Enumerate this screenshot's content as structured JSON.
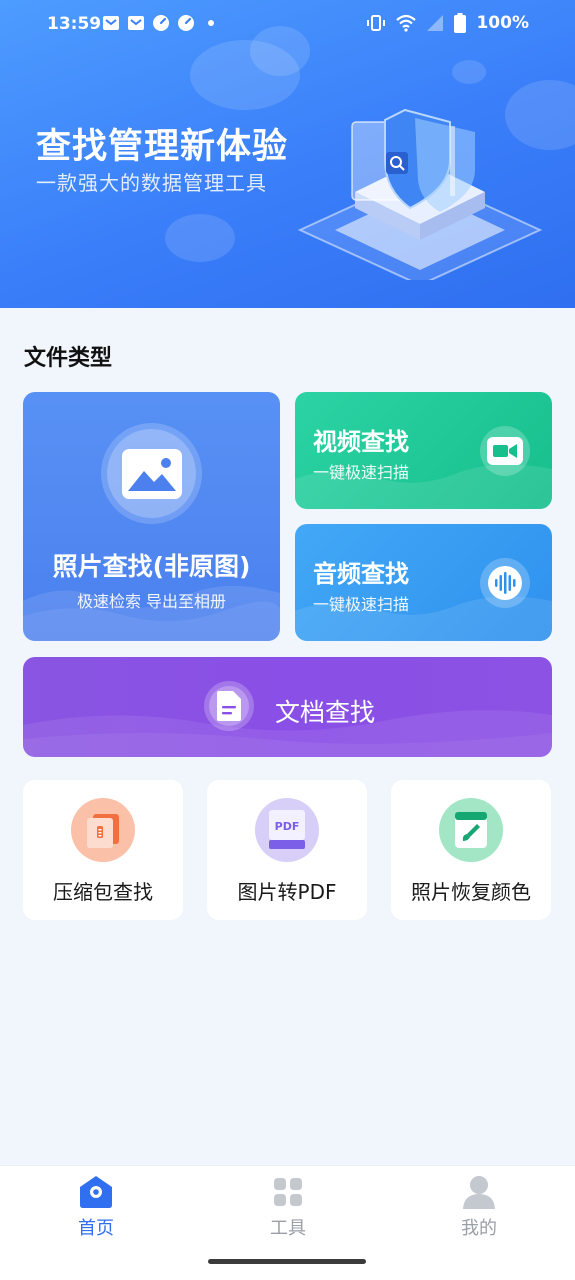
{
  "status_bar": {
    "time": "13:59",
    "battery": "100%",
    "icons": [
      "mail-icon",
      "mail-icon",
      "speedometer-icon",
      "speedometer-icon",
      "dot-icon",
      "vibrate-icon",
      "wifi-icon",
      "signal-icon",
      "battery-icon"
    ]
  },
  "hero": {
    "title": "查找管理新体验",
    "subtitle": "一款强大的数据管理工具"
  },
  "section": {
    "title": "文件类型"
  },
  "cards": {
    "photo": {
      "title": "照片查找(非原图)",
      "subtitle": "极速检索 导出至相册",
      "icon": "image-icon"
    },
    "video": {
      "title": "视频查找",
      "subtitle": "一键极速扫描",
      "icon": "video-camera-icon"
    },
    "audio": {
      "title": "音频查找",
      "subtitle": "一键极速扫描",
      "icon": "sound-wave-icon"
    },
    "document": {
      "title": "文档查找",
      "icon": "document-icon"
    }
  },
  "tools": [
    {
      "label": "压缩包查找",
      "icon": "zip-file-icon"
    },
    {
      "label": "图片转PDF",
      "icon": "pdf-icon",
      "icon_text": "PDF"
    },
    {
      "label": "照片恢复颜色",
      "icon": "paint-brush-icon"
    }
  ],
  "bottom_nav": {
    "active": "首页",
    "items": [
      {
        "label": "首页",
        "icon": "home-icon"
      },
      {
        "label": "工具",
        "icon": "grid-icon"
      },
      {
        "label": "我的",
        "icon": "user-icon"
      }
    ]
  },
  "colors": {
    "primary": "#2f6ff0",
    "hero_bg": "#3a7ef9",
    "photo_card": "#4b80ee",
    "video_card": "#16bf8c",
    "audio_card": "#2f91ee",
    "doc_card": "#8a4fe6",
    "page_bg": "#f1f5fc"
  }
}
